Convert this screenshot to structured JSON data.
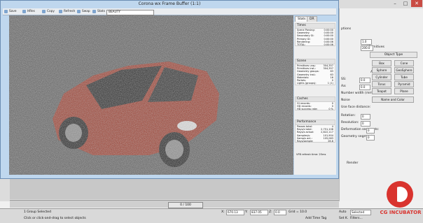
{
  "vfb": {
    "title": "Corona wx Frame Buffer (1:1)",
    "toolbar": [
      "Save",
      "HRes",
      "Copy",
      "Refresh",
      "Swap",
      "Stats"
    ],
    "pass": "BEAUTY",
    "tabs": [
      "Stats",
      "DR"
    ],
    "stats": {
      "times": {
        "title": "Times",
        "rows": [
          [
            "Scene Parsing:",
            "0:00:00"
          ],
          [
            "Geometry:",
            "0:00:00"
          ],
          [
            "Secondary GI:",
            "0:00:00"
          ],
          [
            "Primary GI:",
            "0:00:00"
          ],
          [
            "Rendering:",
            "0:00:06"
          ],
          [
            "TOTAL:",
            "0:00:06"
          ]
        ]
      },
      "scene": {
        "title": "Scene",
        "rows": [
          [
            "Primitives unq.:",
            "304,357"
          ],
          [
            "Primitives inst.:",
            "304,357"
          ],
          [
            "Geometry groups:",
            "63"
          ],
          [
            "Geometry inst.:",
            "63"
          ],
          [
            "Materials:",
            "16"
          ],
          [
            "Portals:",
            "0"
          ],
          [
            "Lights (groups):",
            "1 (1)"
          ]
        ]
      },
      "caches": {
        "title": "Caches",
        "rows": [
          [
            "GI records:",
            "0"
          ],
          [
            "HD records:",
            "0"
          ],
          [
            "HD success rate:",
            "0 %"
          ]
        ]
      },
      "perf": {
        "title": "Performance",
        "rows": [
          [
            "Passes total:",
            "4"
          ],
          [
            "Rays/s total:",
            "2,751,108"
          ],
          [
            "Rays/s actual:",
            "2,822,117"
          ],
          [
            "Samples/s:",
            "101,904"
          ],
          [
            "Samp/s act.:",
            "105,063"
          ],
          [
            "Rays/sample:",
            "26.8"
          ]
        ]
      },
      "vfb_status": "VFB refresh time: 25ms"
    }
  },
  "max": {
    "window_controls": [
      "–",
      "□",
      "✕"
    ],
    "top_icons": [
      "Render"
    ],
    "panel_rows": [
      "nd Primitives",
      "Object Type",
      "AutoGrid"
    ],
    "buttons": [
      [
        "Box",
        "Cone"
      ],
      [
        "Sphere",
        "GeoSphere"
      ],
      [
        "Cylinder",
        "Tube"
      ],
      [
        "Torus",
        "Pyramid"
      ],
      [
        "Teapot",
        "Plane"
      ]
    ],
    "name_color": "Name and Color",
    "param_labels": [
      "ptions",
      "SS:",
      "Aa:",
      "Number width (mm):",
      "Noise",
      "Use face distance:",
      "Rotation:",
      "Resolution:",
      "Deformation segments:",
      "Geometry segments:",
      "Render"
    ],
    "spin_values": [
      "1.0",
      "200.0",
      "0.0",
      "0.0",
      "0",
      "0",
      "0",
      "0"
    ],
    "status": {
      "selected": "1 Group Selected",
      "hint": "Click or click-and-drag to select objects",
      "x_label": "X:",
      "x_val": "670.13",
      "y_label": "Y:",
      "y_val": "837.05",
      "z_label": "Z:",
      "z_val": "0.0",
      "grid": "Grid = 10.0",
      "add_time_tag": "Add Time Tag",
      "auto": "Auto",
      "selected_dd": "Selected",
      "set_k": "Set K.",
      "filters": "Filters..."
    },
    "timeline": "0 / 100"
  },
  "watermark": "CG INCUBATOR"
}
